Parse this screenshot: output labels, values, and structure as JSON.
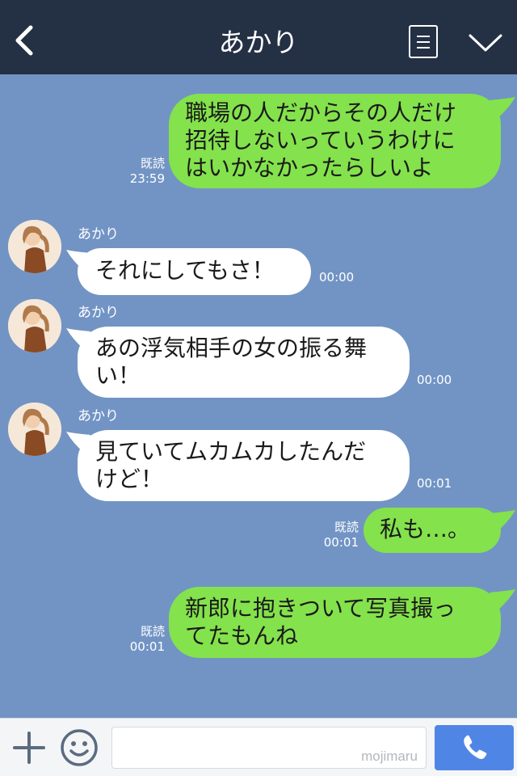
{
  "header": {
    "title": "あかり"
  },
  "messages": [
    {
      "side": "out",
      "text": "職場の人だからその人だけ\n招待しないっていうわけに\nはいかなかったらしいよ",
      "read": "既読",
      "time": "23:59"
    },
    {
      "side": "in",
      "sender": "あかり",
      "text": "それにしてもさ！",
      "time": "00:00"
    },
    {
      "side": "in",
      "sender": "あかり",
      "text": "あの浮気相手の女の振る舞\nい！",
      "time": "00:00"
    },
    {
      "side": "in",
      "sender": "あかり",
      "text": "見ていてムカムカしたんだ\nけど！",
      "time": "00:01"
    },
    {
      "side": "out",
      "text": "私も…。",
      "read": "既読",
      "time": "00:01"
    },
    {
      "side": "out",
      "text": "新郎に抱きついて写真撮っ\nてたもんね",
      "read": "既読",
      "time": "00:01"
    }
  ],
  "footer": {
    "watermark": "mojimaru"
  },
  "colors": {
    "header_bg": "#243044",
    "chat_bg": "#7294c4",
    "out_bubble": "#84e24c",
    "in_bubble": "#ffffff",
    "call_button": "#4f86e6"
  }
}
